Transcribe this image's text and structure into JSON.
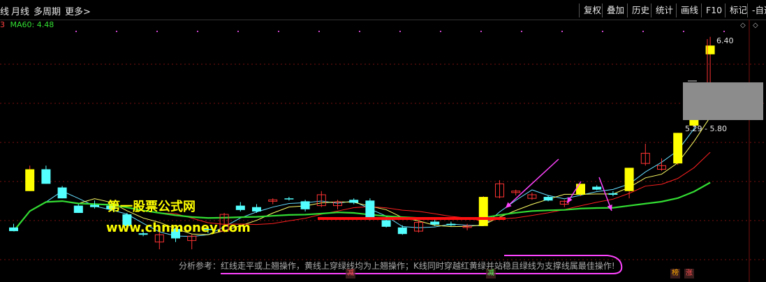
{
  "toolbar": {
    "left_items": [
      "线",
      "月线",
      "多周期",
      "更多>"
    ],
    "right_items": [
      "复权",
      "叠加",
      "历史",
      "统计",
      "画线",
      "F10",
      "标记",
      "-自选"
    ]
  },
  "ma_legend": {
    "prefix": "3",
    "label": "MA60: 4.48"
  },
  "price_labels": {
    "high": "6.40",
    "range": "5.29 - 5.80"
  },
  "watermark": {
    "line1": "第一股票公式网",
    "line2": "www.chnmoney.com"
  },
  "note_text": "分析参考：红线走平或上翘操作，黄线上穿绿线均为上翘操作；K线同时穿越红黄绿并站稳且绿线为支撑线属最佳操作!",
  "badges": [
    {
      "text": "减",
      "color": "#ff5050"
    },
    {
      "text": "减",
      "color": "#50ff50"
    },
    {
      "text": "榜",
      "color": "#ffaa00"
    },
    {
      "text": "涨",
      "color": "#ff5050"
    }
  ],
  "colors": {
    "up": "#ff3232",
    "down": "#54ffff",
    "signal": "#ffff00",
    "ma_red": "#ff2020",
    "ma_yellow": "#ffff66",
    "ma_green": "#33dd33",
    "ma_cyan": "#66ddff",
    "arrow": "#ff44ff",
    "support": "#ff1010"
  },
  "chart_data": {
    "type": "candlestick",
    "ylim": [
      3.4,
      6.7
    ],
    "candles": [
      {
        "o": 3.9,
        "h": 3.95,
        "l": 3.85,
        "c": 3.85,
        "k": "down"
      },
      {
        "o": 4.7,
        "h": 4.75,
        "l": 4.4,
        "c": 4.4,
        "k": "signal"
      },
      {
        "o": 4.7,
        "h": 4.75,
        "l": 4.5,
        "c": 4.5,
        "k": "down"
      },
      {
        "o": 4.45,
        "h": 4.47,
        "l": 4.3,
        "c": 4.3,
        "k": "down"
      },
      {
        "o": 4.2,
        "h": 4.22,
        "l": 4.1,
        "c": 4.1,
        "k": "down"
      },
      {
        "o": 4.21,
        "h": 4.27,
        "l": 4.16,
        "c": 4.18,
        "k": "down"
      },
      {
        "o": 4.2,
        "h": 4.23,
        "l": 4.13,
        "c": 4.15,
        "k": "down"
      },
      {
        "o": 4.08,
        "h": 4.1,
        "l": 3.9,
        "c": 3.92,
        "k": "down"
      },
      {
        "o": 3.82,
        "h": 3.85,
        "l": 3.78,
        "c": 3.8,
        "k": "down"
      },
      {
        "o": 3.7,
        "h": 3.9,
        "l": 3.6,
        "c": 3.8,
        "k": "up"
      },
      {
        "o": 3.88,
        "h": 3.9,
        "l": 3.7,
        "c": 3.75,
        "k": "down"
      },
      {
        "o": 3.72,
        "h": 3.8,
        "l": 3.6,
        "c": 3.78,
        "k": "up"
      },
      {
        "o": 3.88,
        "h": 3.9,
        "l": 3.82,
        "c": 3.87,
        "k": "down"
      },
      {
        "o": 3.85,
        "h": 4.1,
        "l": 3.83,
        "c": 4.08,
        "k": "up"
      },
      {
        "o": 4.2,
        "h": 4.25,
        "l": 4.12,
        "c": 4.14,
        "k": "down"
      },
      {
        "o": 4.18,
        "h": 4.22,
        "l": 4.1,
        "c": 4.12,
        "k": "down"
      },
      {
        "o": 4.26,
        "h": 4.3,
        "l": 4.22,
        "c": 4.28,
        "k": "up"
      },
      {
        "o": 4.3,
        "h": 4.32,
        "l": 4.27,
        "c": 4.29,
        "k": "down"
      },
      {
        "o": 4.26,
        "h": 4.28,
        "l": 4.12,
        "c": 4.15,
        "k": "down"
      },
      {
        "o": 4.2,
        "h": 4.4,
        "l": 4.18,
        "c": 4.35,
        "k": "up"
      },
      {
        "o": 4.25,
        "h": 4.28,
        "l": 4.15,
        "c": 4.2,
        "k": "up"
      },
      {
        "o": 4.28,
        "h": 4.3,
        "l": 4.22,
        "c": 4.24,
        "k": "down"
      },
      {
        "o": 4.27,
        "h": 4.3,
        "l": 4.0,
        "c": 4.02,
        "k": "down"
      },
      {
        "o": 4.0,
        "h": 4.05,
        "l": 3.9,
        "c": 3.91,
        "k": "down"
      },
      {
        "o": 3.9,
        "h": 3.93,
        "l": 3.8,
        "c": 3.81,
        "k": "down"
      },
      {
        "o": 3.85,
        "h": 4.0,
        "l": 3.83,
        "c": 3.97,
        "k": "up"
      },
      {
        "o": 3.98,
        "h": 4.02,
        "l": 3.92,
        "c": 3.94,
        "k": "down"
      },
      {
        "o": 3.95,
        "h": 3.98,
        "l": 3.92,
        "c": 3.93,
        "k": "down"
      },
      {
        "o": 3.9,
        "h": 3.95,
        "l": 3.86,
        "c": 3.92,
        "k": "up"
      },
      {
        "o": 4.32,
        "h": 4.33,
        "l": 3.92,
        "c": 3.92,
        "k": "signal"
      },
      {
        "o": 4.32,
        "h": 4.55,
        "l": 4.3,
        "c": 4.5,
        "k": "up"
      },
      {
        "o": 4.38,
        "h": 4.42,
        "l": 4.34,
        "c": 4.4,
        "k": "up"
      },
      {
        "o": 4.3,
        "h": 4.38,
        "l": 4.28,
        "c": 4.35,
        "k": "up"
      },
      {
        "o": 4.32,
        "h": 4.34,
        "l": 4.26,
        "c": 4.27,
        "k": "down"
      },
      {
        "o": 4.22,
        "h": 4.28,
        "l": 4.18,
        "c": 4.26,
        "k": "up"
      },
      {
        "o": 4.35,
        "h": 4.5,
        "l": 4.33,
        "c": 4.5,
        "k": "signal"
      },
      {
        "o": 4.46,
        "h": 4.48,
        "l": 4.41,
        "c": 4.42,
        "k": "down"
      },
      {
        "o": 4.37,
        "h": 4.4,
        "l": 4.33,
        "c": 4.35,
        "k": "down"
      },
      {
        "o": 4.4,
        "h": 4.72,
        "l": 4.3,
        "c": 4.72,
        "k": "signal"
      },
      {
        "o": 4.78,
        "h": 5.05,
        "l": 4.75,
        "c": 4.92,
        "k": "up"
      },
      {
        "o": 4.7,
        "h": 4.85,
        "l": 4.68,
        "c": 4.75,
        "k": "up"
      },
      {
        "o": 4.78,
        "h": 5.2,
        "l": 4.76,
        "c": 5.2,
        "k": "signal"
      },
      {
        "o": 5.3,
        "h": 5.82,
        "l": 5.28,
        "c": 5.82,
        "k": "signal"
      },
      {
        "o": 6.28,
        "h": 6.52,
        "l": 5.8,
        "c": 6.4,
        "k": "signal"
      }
    ]
  }
}
